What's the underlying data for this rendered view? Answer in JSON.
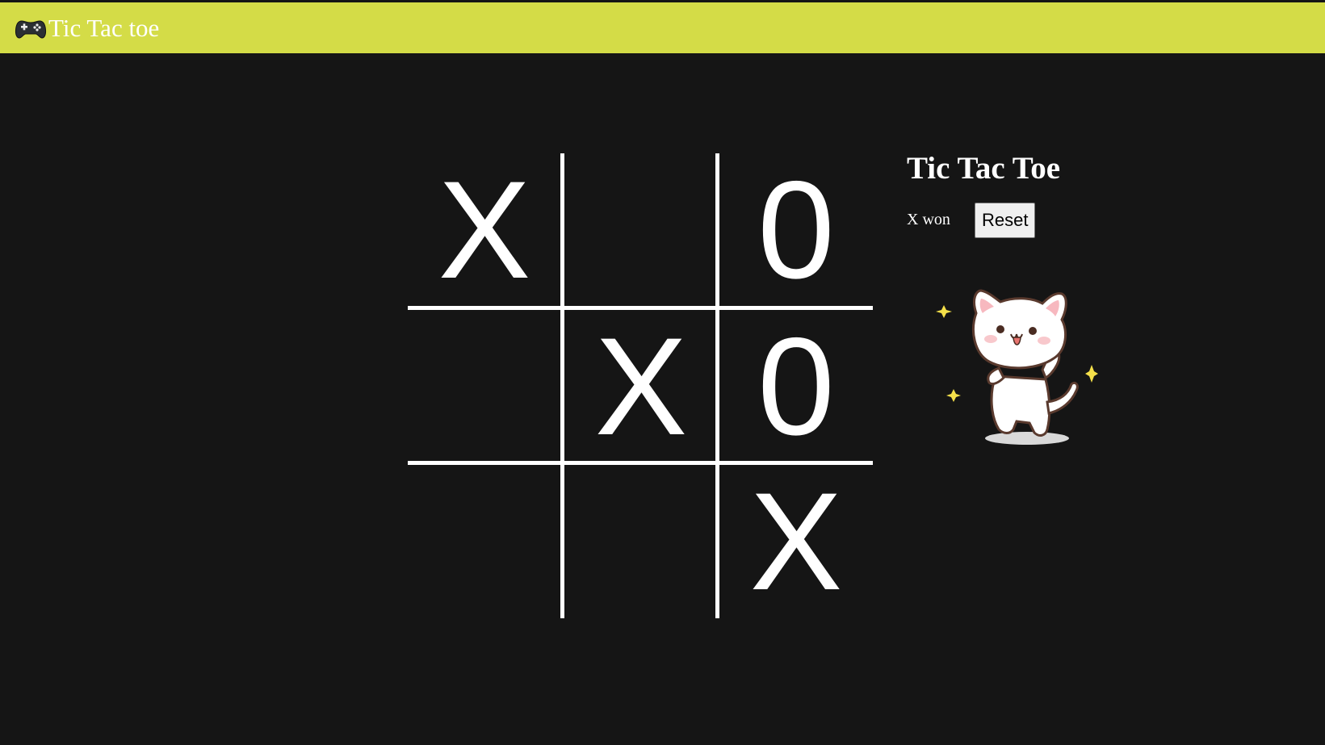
{
  "header": {
    "title": "Tic Tac toe",
    "icon": "game-controller-icon",
    "background": "#d4dc47"
  },
  "board": {
    "cells": [
      "X",
      "",
      "0",
      "",
      "X",
      "0",
      "",
      "",
      "X"
    ]
  },
  "panel": {
    "title": "Tic Tac Toe",
    "status": "X won",
    "reset_label": "Reset"
  },
  "celebration": {
    "icon": "dancing-cat-sticker"
  },
  "colors": {
    "page_background": "#151515",
    "grid_lines": "#ffffff",
    "sparkle": "#f5e04a"
  }
}
